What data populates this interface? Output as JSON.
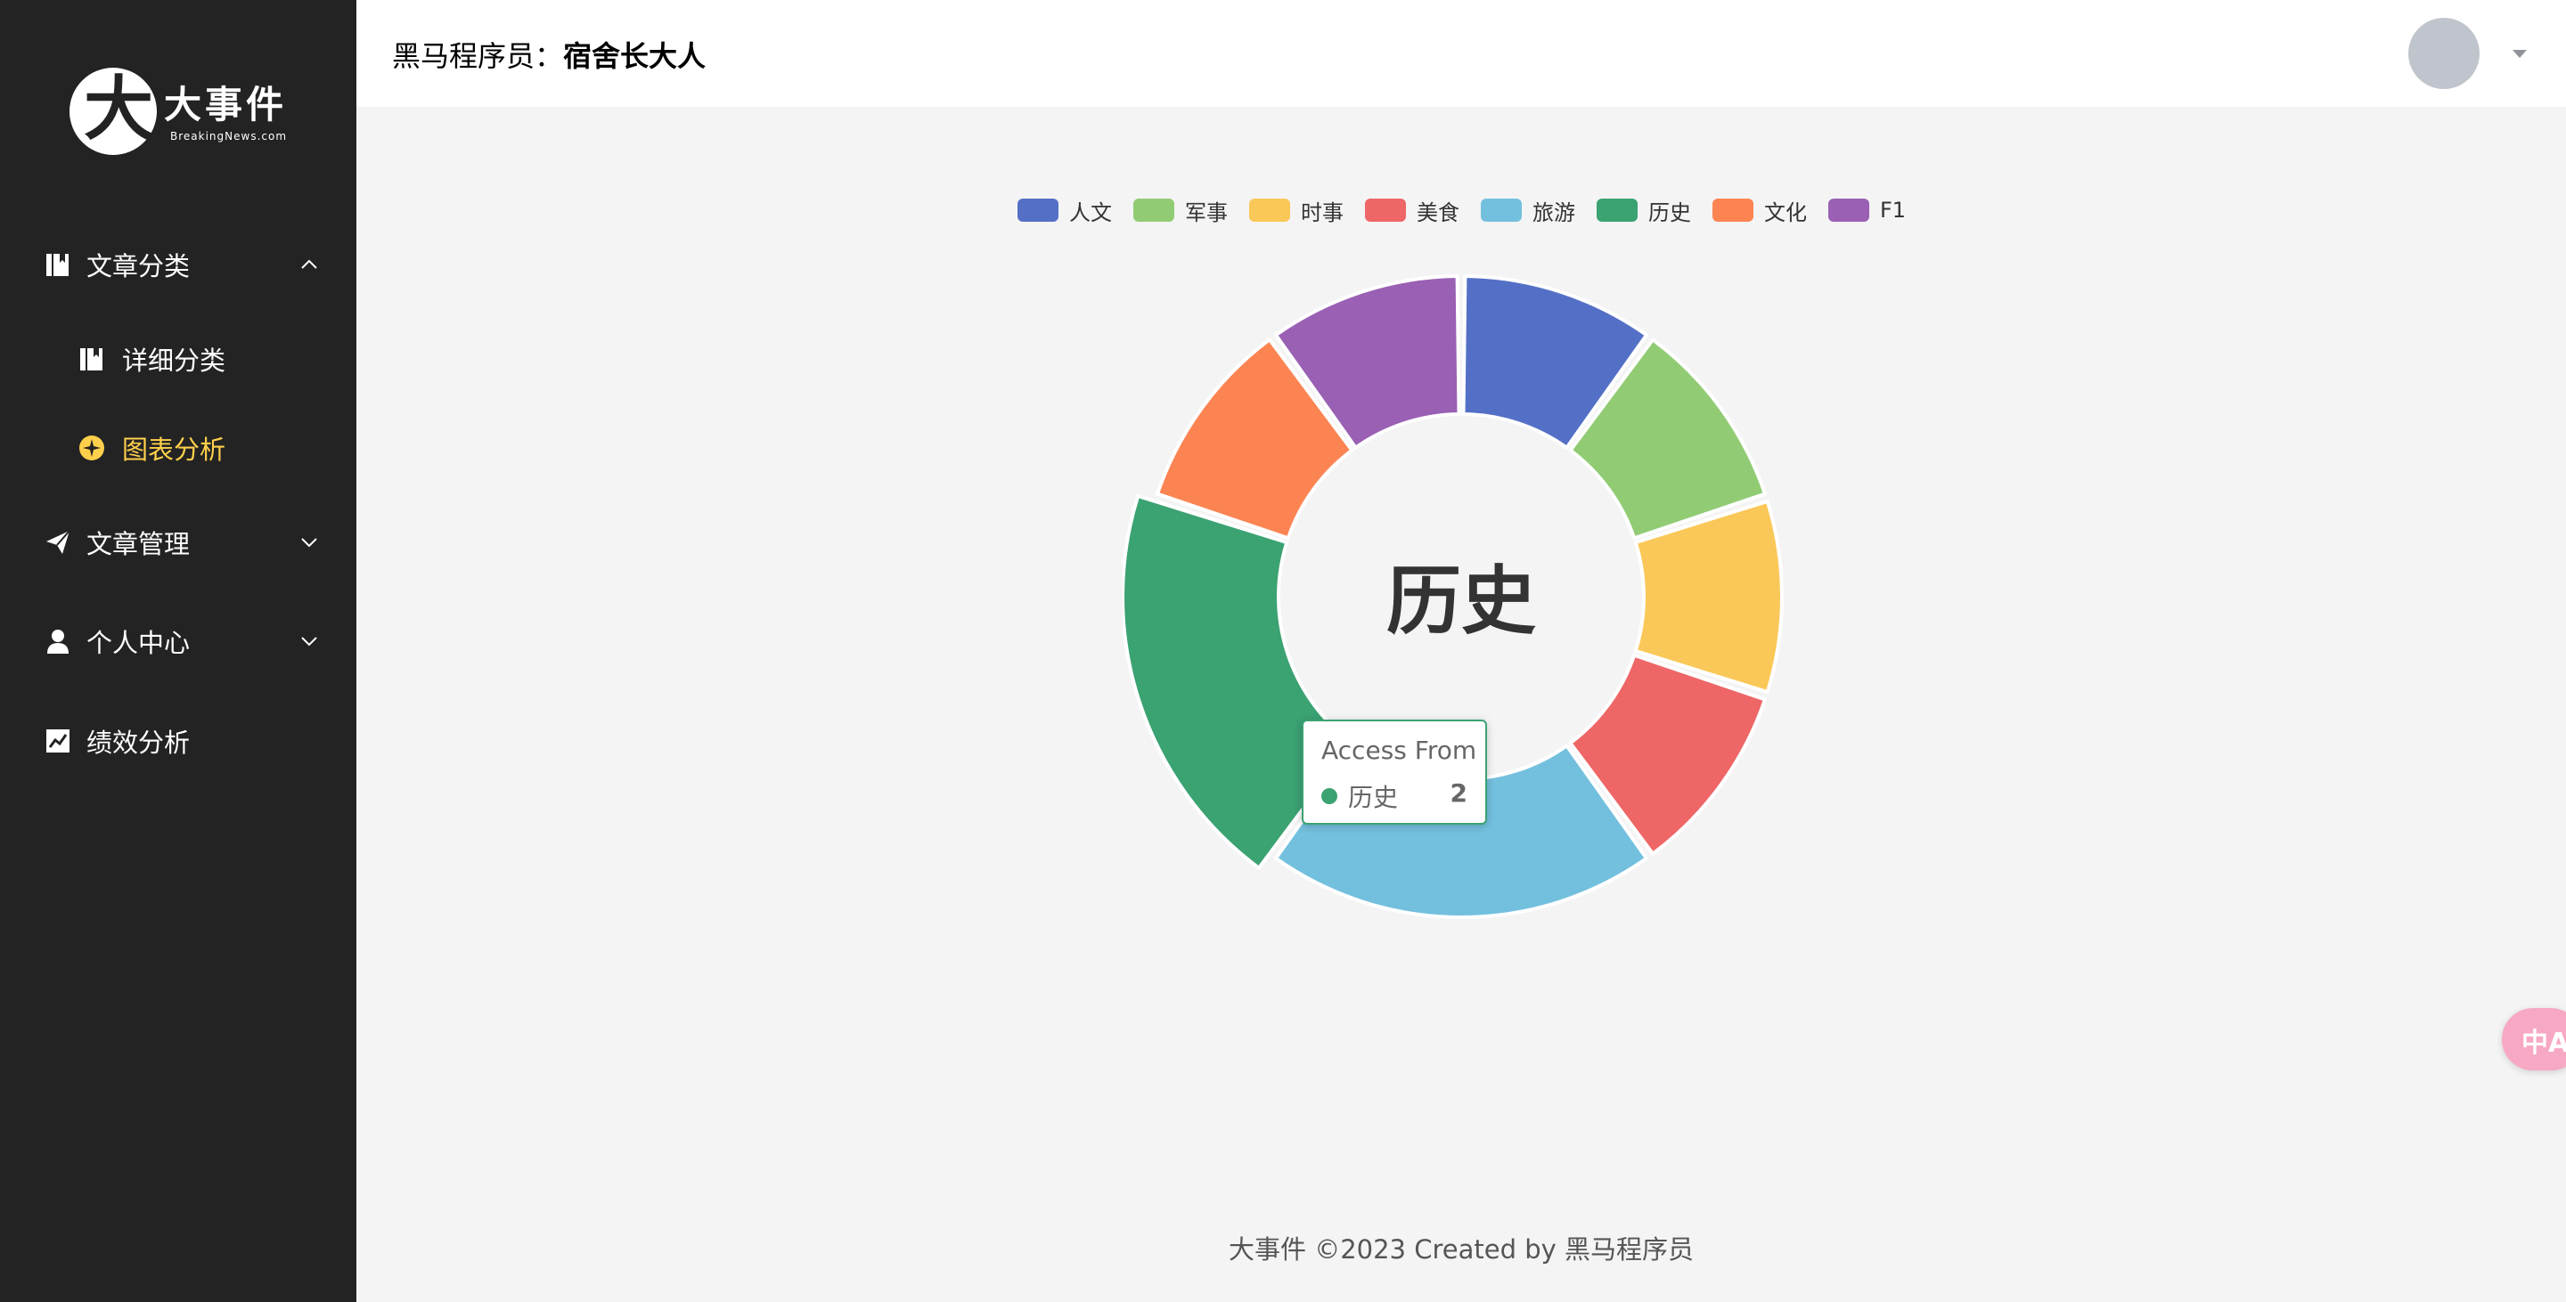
{
  "sidebar": {
    "logo": {
      "title": "大事件",
      "subtitle": "BreakingNews.com"
    },
    "items": [
      {
        "label": "文章分类",
        "icon": "book-icon",
        "expanded": true
      },
      {
        "label": "详细分类",
        "icon": "book-icon"
      },
      {
        "label": "图表分析",
        "icon": "chart-icon",
        "active": true
      },
      {
        "label": "文章管理",
        "icon": "send-icon",
        "expanded": false
      },
      {
        "label": "个人中心",
        "icon": "user-icon",
        "expanded": false
      },
      {
        "label": "绩效分析",
        "icon": "trend-icon"
      }
    ]
  },
  "header": {
    "prefix": "黑马程序员：",
    "username": "宿舍长大人"
  },
  "colors": {
    "sidebar_bg": "#232323",
    "active_menu": "#ffd04b",
    "page_bg": "#f4f4f4"
  },
  "chart_data": {
    "type": "pie",
    "variant": "donut",
    "legend_position": "top",
    "categories": [
      "人文",
      "军事",
      "时事",
      "美食",
      "旅游",
      "历史",
      "文化",
      "F1"
    ],
    "values": [
      1,
      1,
      1,
      1,
      2,
      2,
      1,
      1
    ],
    "colors": [
      "#5470c6",
      "#91cc75",
      "#fac858",
      "#ee6666",
      "#73c0de",
      "#3ba272",
      "#fc8452",
      "#9a60b4"
    ],
    "center_label": "历史",
    "tooltip": {
      "title": "Access From",
      "name": "历史",
      "value": "2"
    }
  },
  "footer": {
    "text": "大事件 ©2023 Created by 黑马程序员"
  },
  "translate_button": {
    "label": "中A"
  }
}
